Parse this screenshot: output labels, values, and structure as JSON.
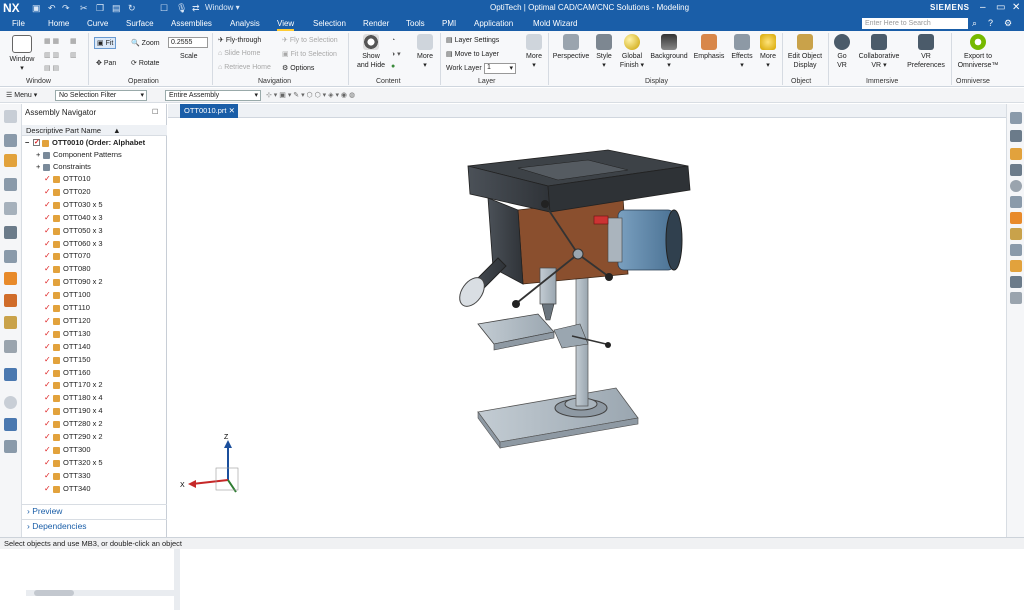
{
  "app": {
    "logo": "NX",
    "window_menu": "Window",
    "window_title": "OptiTech | Optimal CAD/CAM/CNC Solutions - Modeling",
    "brand": "SIEMENS",
    "search_placeholder": "Enter Here to Search"
  },
  "menu": [
    "File",
    "Home",
    "Curve",
    "Surface",
    "Assemblies",
    "Analysis",
    "View",
    "Selection",
    "Render",
    "Tools",
    "PMI",
    "Application",
    "Mold Wizard"
  ],
  "active_menu": "View",
  "ribbon": {
    "window": {
      "label": "Window",
      "group": "Window"
    },
    "operation": {
      "fit": "Fit",
      "zoom": "Zoom",
      "pan": "Pan",
      "rotate": "Rotate",
      "scale_value": "0.2555",
      "scale": "Scale",
      "group": "Operation"
    },
    "navigation": {
      "fly": "Fly-through",
      "slide": "Slide Home",
      "retrieve": "Retrieve Home",
      "fly_sel": "Fly to Selection",
      "fit_sel": "Fit to Selection",
      "options": "Options",
      "group": "Navigation"
    },
    "content": {
      "show_hide_1": "Show",
      "show_hide_2": "and Hide",
      "more": "More",
      "group": "Content"
    },
    "layer": {
      "settings": "Layer Settings",
      "move": "Move to Layer",
      "work_layer": "Work Layer",
      "work_layer_value": "1",
      "more": "More",
      "group": "Layer"
    },
    "display": {
      "perspective": "Perspective",
      "style": "Style",
      "global": "Global",
      "finish": "Finish",
      "background": "Background",
      "emphasis": "Emphasis",
      "effects": "Effects",
      "more": "More",
      "group": "Display"
    },
    "object": {
      "edit1": "Edit Object",
      "edit2": "Display",
      "group": "Object"
    },
    "immersive": {
      "go": "Go",
      "vr": "VR",
      "collab": "Collaborative",
      "collab_vr": "VR",
      "vrpref1": "VR",
      "vrpref2": "Preferences",
      "group": "Immersive"
    },
    "omniverse": {
      "export1": "Export to",
      "export2": "Omniverse™",
      "group": "Omniverse"
    }
  },
  "toolbar": {
    "menu": "Menu",
    "filter": "No Selection Filter",
    "scope": "Entire Assembly"
  },
  "navigator": {
    "title": "Assembly Navigator",
    "column": "Descriptive Part Name",
    "root": "OTT0010 (Order: Alphabet",
    "groups": [
      "Component Patterns",
      "Constraints"
    ],
    "parts": [
      "OTT010",
      "OTT020",
      "OTT030 x 5",
      "OTT040 x 3",
      "OTT050 x 3",
      "OTT060 x 3",
      "OTT070",
      "OTT080",
      "OTT090 x 2",
      "OTT100",
      "OTT110",
      "OTT120",
      "OTT130",
      "OTT140",
      "OTT150",
      "OTT160",
      "OTT170 x 2",
      "OTT180 x 4",
      "OTT190 x 4",
      "OTT280 x 2",
      "OTT290 x 2",
      "OTT300",
      "OTT320 x 5",
      "OTT330",
      "OTT340"
    ],
    "preview": "Preview",
    "dependencies": "Dependencies"
  },
  "doc_tab": "OTT0010.prt",
  "triad": {
    "x": "X",
    "z": "Z"
  },
  "status": "Select objects and use MB3, or double-click an object",
  "colors": {
    "brand_blue": "#1a5ea8",
    "motor": "#5a86a8",
    "housing": "#8a4f2e",
    "body_gray": "#b9c4cc"
  }
}
